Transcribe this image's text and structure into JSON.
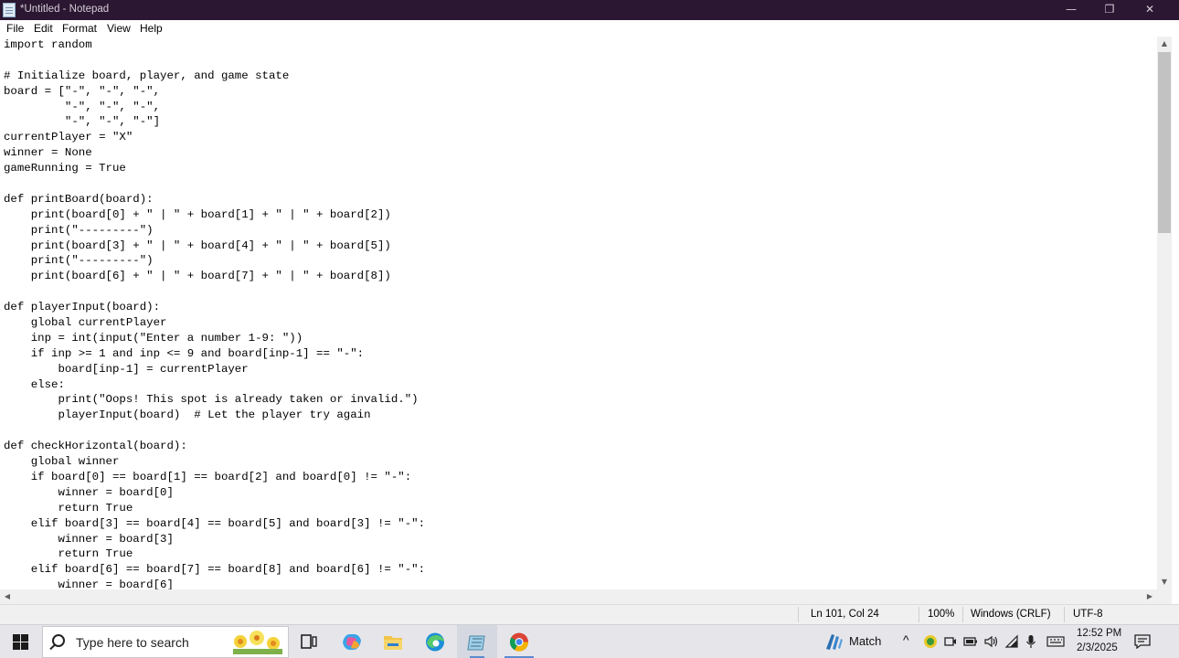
{
  "window": {
    "title": "*Untitled - Notepad",
    "controls": {
      "minimize": "—",
      "maximize": "❐",
      "close": "✕"
    }
  },
  "menu": [
    "File",
    "Edit",
    "Format",
    "View",
    "Help"
  ],
  "editor": {
    "lines": [
      "import random",
      "",
      "# Initialize board, player, and game state",
      "board = [\"-\", \"-\", \"-\",",
      "         \"-\", \"-\", \"-\",",
      "         \"-\", \"-\", \"-\"]",
      "currentPlayer = \"X\"",
      "winner = None",
      "gameRunning = True",
      "",
      "def printBoard(board):",
      "    print(board[0] + \" | \" + board[1] + \" | \" + board[2])",
      "    print(\"---------\")",
      "    print(board[3] + \" | \" + board[4] + \" | \" + board[5])",
      "    print(\"---------\")",
      "    print(board[6] + \" | \" + board[7] + \" | \" + board[8])",
      "",
      "def playerInput(board):",
      "    global currentPlayer",
      "    inp = int(input(\"Enter a number 1-9: \"))",
      "    if inp >= 1 and inp <= 9 and board[inp-1] == \"-\":",
      "        board[inp-1] = currentPlayer",
      "    else:",
      "        print(\"Oops! This spot is already taken or invalid.\")",
      "        playerInput(board)  # Let the player try again",
      "",
      "def checkHorizontal(board):",
      "    global winner",
      "    if board[0] == board[1] == board[2] and board[0] != \"-\":",
      "        winner = board[0]",
      "        return True",
      "    elif board[3] == board[4] == board[5] and board[3] != \"-\":",
      "        winner = board[3]",
      "        return True",
      "    elif board[6] == board[7] == board[8] and board[6] != \"-\":",
      "        winner = board[6]"
    ]
  },
  "status": {
    "position": "Ln 101, Col 24",
    "zoom": "100%",
    "line_ending": "Windows (CRLF)",
    "encoding": "UTF-8"
  },
  "taskbar": {
    "search_placeholder": "Type here to search",
    "weather_text": "Match",
    "time": "12:52 PM",
    "date": "2/3/2025",
    "tray_overflow": "^"
  },
  "colors": {
    "titlebar": "#2b1731",
    "accent": "#5b8bd0"
  }
}
